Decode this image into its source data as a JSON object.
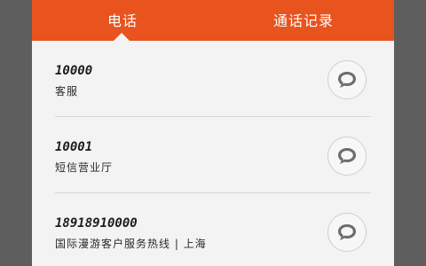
{
  "tabs": [
    {
      "label": "电话"
    },
    {
      "label": "通话记录"
    }
  ],
  "contacts": [
    {
      "number": "10000",
      "description": "客服"
    },
    {
      "number": "10001",
      "description": "短信营业厅"
    },
    {
      "number": "18918910000",
      "description": "国际漫游客户服务热线 | 上海"
    }
  ],
  "colors": {
    "accent": "#e8531e",
    "background": "#f3f3f3"
  },
  "icons": {
    "row_action": "speech-bubble-icon"
  }
}
